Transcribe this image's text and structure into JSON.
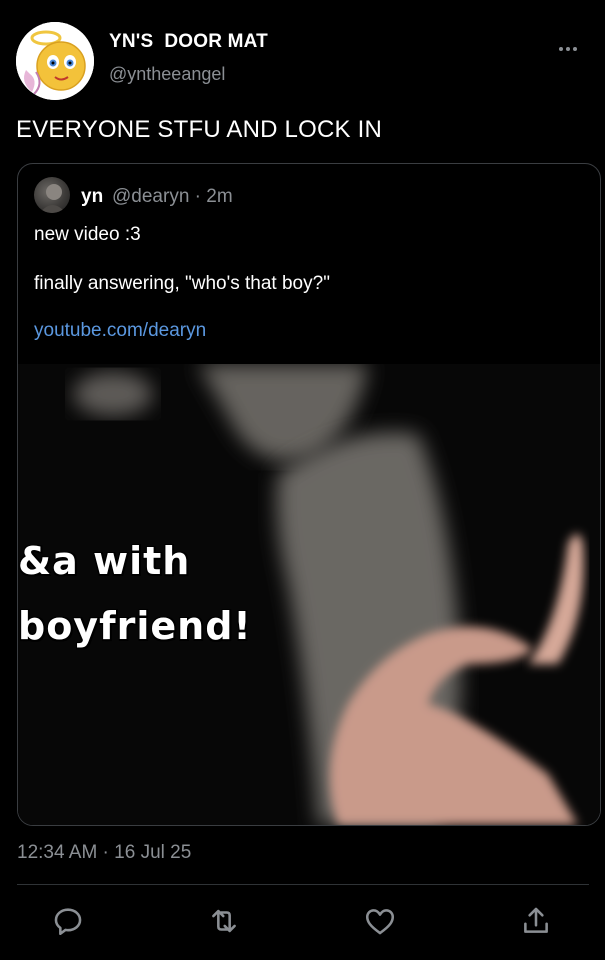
{
  "author": {
    "display_name": "YN'S  DOOR MAT",
    "handle": "@yntheeangel",
    "avatar_icon": "smiley-angel-avatar-icon"
  },
  "tweet": {
    "text": "EVERYONE STFU AND LOCK IN",
    "timestamp": "12:34 AM · 16 Jul 25"
  },
  "quoted_tweet": {
    "name": "yn",
    "meta": "@dearyn · 2m",
    "line1": "new video :3",
    "line2": "finally answering, \"who's that boy?\"",
    "link": "youtube.com/dearyn",
    "media_text_line1": "&a with",
    "media_text_line2": "boyfriend!"
  },
  "actions": [
    "reply-icon",
    "retweet-icon",
    "like-icon",
    "share-icon"
  ],
  "colors": {
    "background": "#000000",
    "link": "#5b98e0",
    "secondary_text": "#8b8f94"
  }
}
